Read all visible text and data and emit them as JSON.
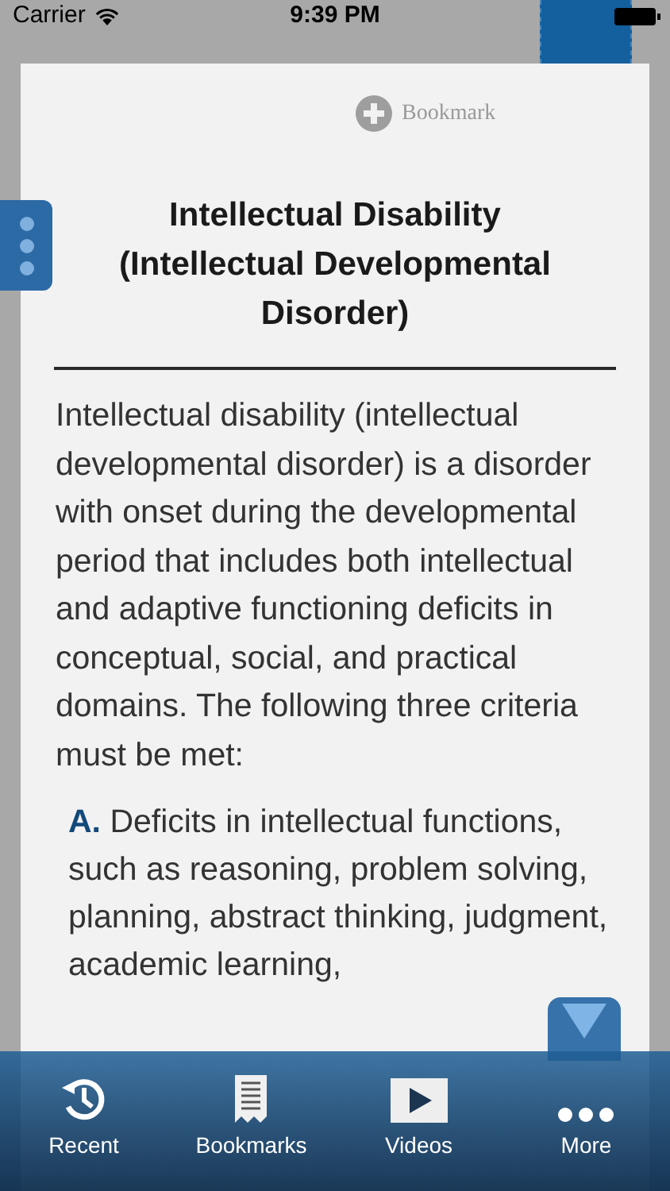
{
  "status_bar": {
    "carrier": "Carrier",
    "time": "9:39 PM"
  },
  "bookmark_button": {
    "label": "Bookmark"
  },
  "article": {
    "title": "Intellectual Disability (Intellectual Developmental Disorder)",
    "intro": "Intellectual disability (intellectual developmental disorder) is a disorder with onset during the developmental period that includes both intellectual and adaptive functioning deficits in conceptual, social, and practical domains. The following three criteria must be met:",
    "criteria": [
      {
        "letter": "A.",
        "text": "Deficits in intellectual functions, such as reasoning, problem solving, planning, abstract thinking, judgment, academic learning,"
      }
    ]
  },
  "tab_bar": [
    {
      "label": "Recent",
      "kind": "recent"
    },
    {
      "label": "Bookmarks",
      "kind": "bookmarks"
    },
    {
      "label": "Videos",
      "kind": "videos"
    },
    {
      "label": "More",
      "kind": "more"
    }
  ]
}
